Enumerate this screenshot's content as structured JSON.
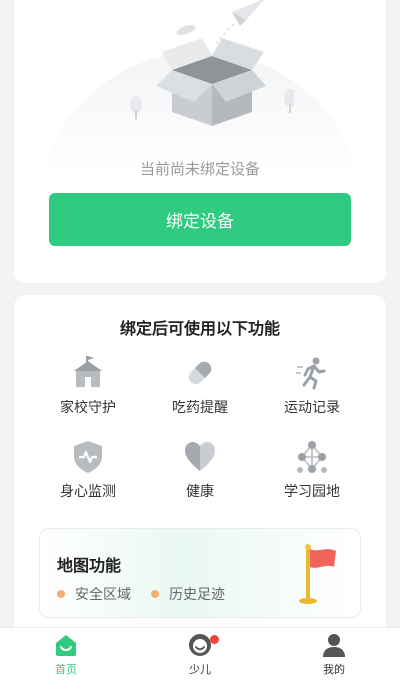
{
  "empty_state": {
    "message": "当前尚未绑定设备",
    "bind_button": "绑定设备"
  },
  "features": {
    "title": "绑定后可使用以下功能",
    "items": [
      {
        "label": "家校守护",
        "icon": "school-icon"
      },
      {
        "label": "吃药提醒",
        "icon": "pill-icon"
      },
      {
        "label": "运动记录",
        "icon": "running-icon"
      },
      {
        "label": "身心监测",
        "icon": "shield-heartbeat-icon"
      },
      {
        "label": "健康",
        "icon": "heart-icon"
      },
      {
        "label": "学习园地",
        "icon": "network-icon"
      }
    ]
  },
  "map": {
    "title": "地图功能",
    "items": [
      "安全区域",
      "历史足迹"
    ],
    "dot_color": "#f6ae72"
  },
  "tabbar": {
    "items": [
      {
        "label": "首页",
        "icon": "home-icon",
        "active": true
      },
      {
        "label": "少儿",
        "icon": "kid-face-icon",
        "badge": true
      },
      {
        "label": "我的",
        "icon": "user-icon"
      }
    ]
  },
  "colors": {
    "accent": "#2fcb80",
    "badge": "#f2453d"
  }
}
